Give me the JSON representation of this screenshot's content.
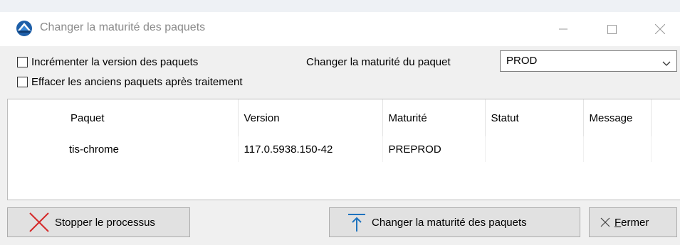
{
  "window": {
    "title": "Changer la maturité des paquets",
    "controls": [
      "minimize",
      "maximize",
      "close"
    ]
  },
  "options": {
    "increment_version_label": "Incrémenter la version des paquets",
    "increment_version_checked": false,
    "delete_old_label": "Effacer les anciens paquets après traitement",
    "delete_old_checked": false,
    "maturity_label": "Changer la maturité du paquet",
    "maturity_value": "PROD"
  },
  "table": {
    "columns": [
      "Paquet",
      "Version",
      "Maturité",
      "Statut",
      "Message"
    ],
    "rows": [
      {
        "paquet": "tis-chrome",
        "version": "117.0.5938.150-42",
        "maturite": "PREPROD",
        "statut": "",
        "message": ""
      }
    ]
  },
  "buttons": {
    "stop_label": "Stopper le processus",
    "change_label": "Changer la maturité des paquets",
    "close_prefix": "F",
    "close_rest": "ermer"
  },
  "icons": {
    "app": "wapt-logo-icon",
    "stop": "red-x-icon",
    "change": "arrow-up-icon",
    "close": "x-icon"
  },
  "colors": {
    "accent_blue": "#1e73be",
    "stop_red": "#d42a2a"
  }
}
